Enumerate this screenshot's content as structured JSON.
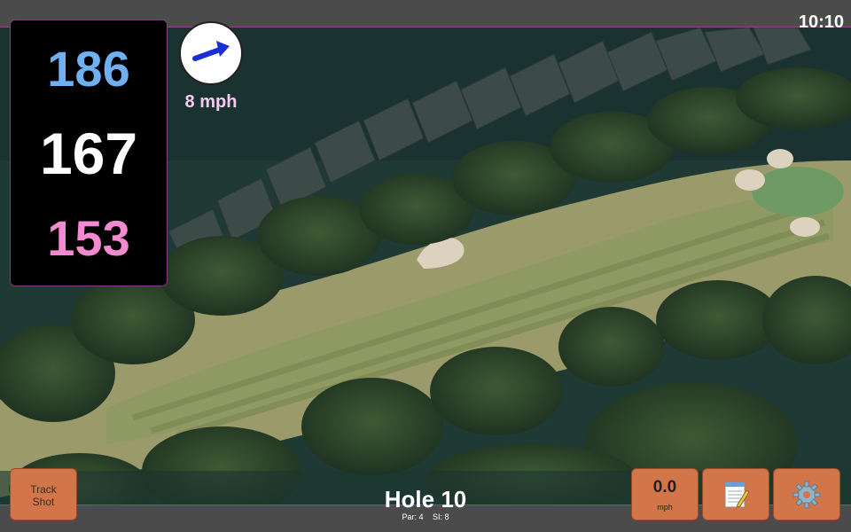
{
  "status": {
    "time": "10:10"
  },
  "distances": {
    "back": "186",
    "middle": "167",
    "front": "153"
  },
  "wind": {
    "speed": "8 mph",
    "arrow_icon": "wind-arrow-icon"
  },
  "hole": {
    "title": "Hole 10",
    "par": "Par: 4",
    "si": "SI: 8"
  },
  "buttons": {
    "track_shot_line1": "Track",
    "track_shot_line2": "Shot",
    "speed_value": "0.0",
    "speed_unit": "mph",
    "notes_icon": "notepad-icon",
    "settings_icon": "gear-icon"
  },
  "colors": {
    "back_distance": "#6fb0f2",
    "middle_distance": "#ffffff",
    "front_distance": "#f18ad0",
    "button": "#d2764a",
    "accent_border": "#8a4a8a"
  }
}
